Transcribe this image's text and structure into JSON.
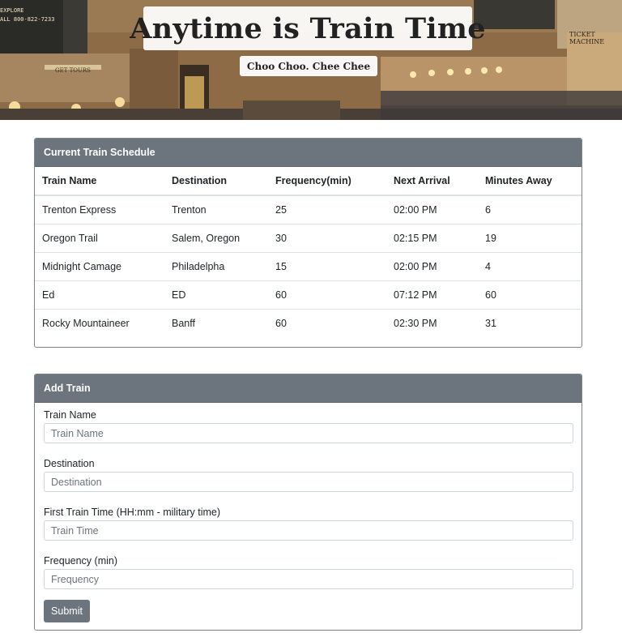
{
  "hero": {
    "title": "Anytime is Train Time",
    "subtitle": "Choo Choo. Chee Chee",
    "signs": {
      "gate_sign": "GET TOURS",
      "ticket_sign": "TICKET MACHINE",
      "board_lines": [
        "EXPLORE",
        "ALL 800-822-7233"
      ]
    }
  },
  "schedule": {
    "header": "Current Train Schedule",
    "columns": [
      "Train Name",
      "Destination",
      "Frequency(min)",
      "Next Arrival",
      "Minutes Away"
    ],
    "rows": [
      [
        "Trenton Express",
        "Trenton",
        "25",
        "02:00 PM",
        "6"
      ],
      [
        "Oregon Trail",
        "Salem, Oregon",
        "30",
        "02:15 PM",
        "19"
      ],
      [
        "Midnight Camage",
        "Philadelpha",
        "15",
        "02:00 PM",
        "4"
      ],
      [
        "Ed",
        "ED",
        "60",
        "07:12 PM",
        "60"
      ],
      [
        "Rocky Mountaineer",
        "Banff",
        "60",
        "02:30 PM",
        "31"
      ]
    ]
  },
  "form": {
    "header": "Add Train",
    "fields": [
      {
        "label": "Train Name",
        "placeholder": "Train Name"
      },
      {
        "label": "Destination",
        "placeholder": "Destination"
      },
      {
        "label": "First Train Time (HH:mm - military time)",
        "placeholder": "Train Time"
      },
      {
        "label": "Frequency (min)",
        "placeholder": "Frequency"
      }
    ],
    "submit_label": "Submit"
  },
  "colors": {
    "card_header": "#6c757d",
    "button": "#6c757d",
    "border": "#dee2e6"
  }
}
